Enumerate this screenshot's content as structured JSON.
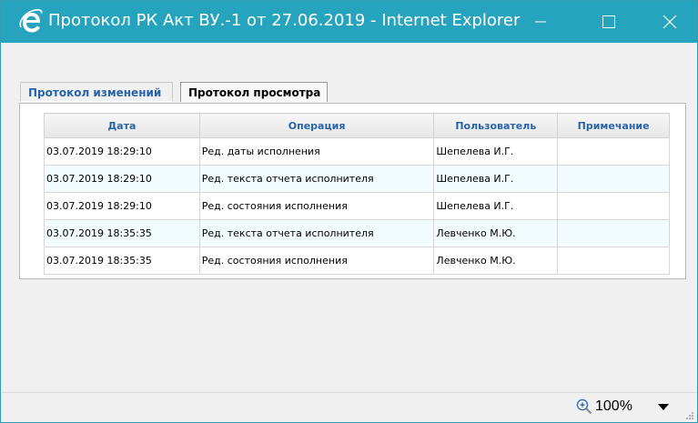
{
  "window": {
    "title": "Протокол РК Акт ВУ.-1 от 27.06.2019 - Internet Explorer",
    "title_color": "#27a4bd",
    "icons": [
      "internet-explorer-icon",
      "minimize-icon",
      "maximize-icon",
      "close-icon"
    ]
  },
  "tabs": [
    {
      "label": "Протокол изменений",
      "active": true
    },
    {
      "label": "Протокол просмотра",
      "active": false
    }
  ],
  "table": {
    "columns": [
      "Дата",
      "Операция",
      "Пользователь",
      "Примечание"
    ],
    "rows": [
      {
        "date": "03.07.2019 18:29:10",
        "operation": "Ред. даты исполнения",
        "user": "Шепелева И.Г.",
        "note": ""
      },
      {
        "date": "03.07.2019 18:29:10",
        "operation": "Ред. текста отчета исполнителя",
        "user": "Шепелева И.Г.",
        "note": ""
      },
      {
        "date": "03.07.2019 18:29:10",
        "operation": "Ред. состояния исполнения",
        "user": "Шепелева И.Г.",
        "note": ""
      },
      {
        "date": "03.07.2019 18:35:35",
        "operation": "Ред. текста отчета исполнителя",
        "user": "Левченко М.Ю.",
        "note": ""
      },
      {
        "date": "03.07.2019 18:35:35",
        "operation": "Ред. состояния исполнения",
        "user": "Левченко М.Ю.",
        "note": ""
      }
    ]
  },
  "statusbar": {
    "zoom": "100%",
    "icons": [
      "zoom-icon",
      "chevron-down-icon",
      "resize-grip-icon"
    ]
  },
  "colors": {
    "header_text": "#2a64a8",
    "alt_row": "#f2fbfd"
  }
}
